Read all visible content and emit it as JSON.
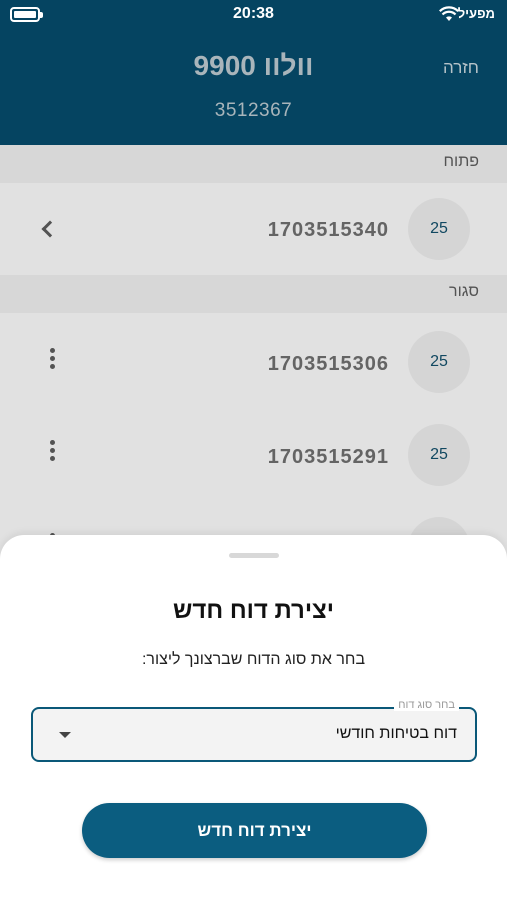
{
  "status_bar": {
    "time": "20:38",
    "carrier": "מפעיל"
  },
  "header": {
    "back_label": "חזרה",
    "title": "וולוו 9900",
    "subtitle": "3512367"
  },
  "sections": {
    "open": {
      "label": "פתוח"
    },
    "closed": {
      "label": "סגור"
    }
  },
  "open_items": [
    {
      "badge": "25",
      "number": "1703515340"
    }
  ],
  "closed_items": [
    {
      "badge": "25",
      "number": "1703515306"
    },
    {
      "badge": "25",
      "number": "1703515291"
    }
  ],
  "sheet": {
    "title": "יצירת דוח חדש",
    "subtitle": "בחר את סוג הדוח שברצונך ליצור:",
    "select_label": "בחר סוג דוח",
    "select_value": "דוח בטיחות חודשי",
    "create_button": "יצירת דוח חדש"
  },
  "colors": {
    "header": "#054461",
    "accent": "#0b5d80"
  }
}
